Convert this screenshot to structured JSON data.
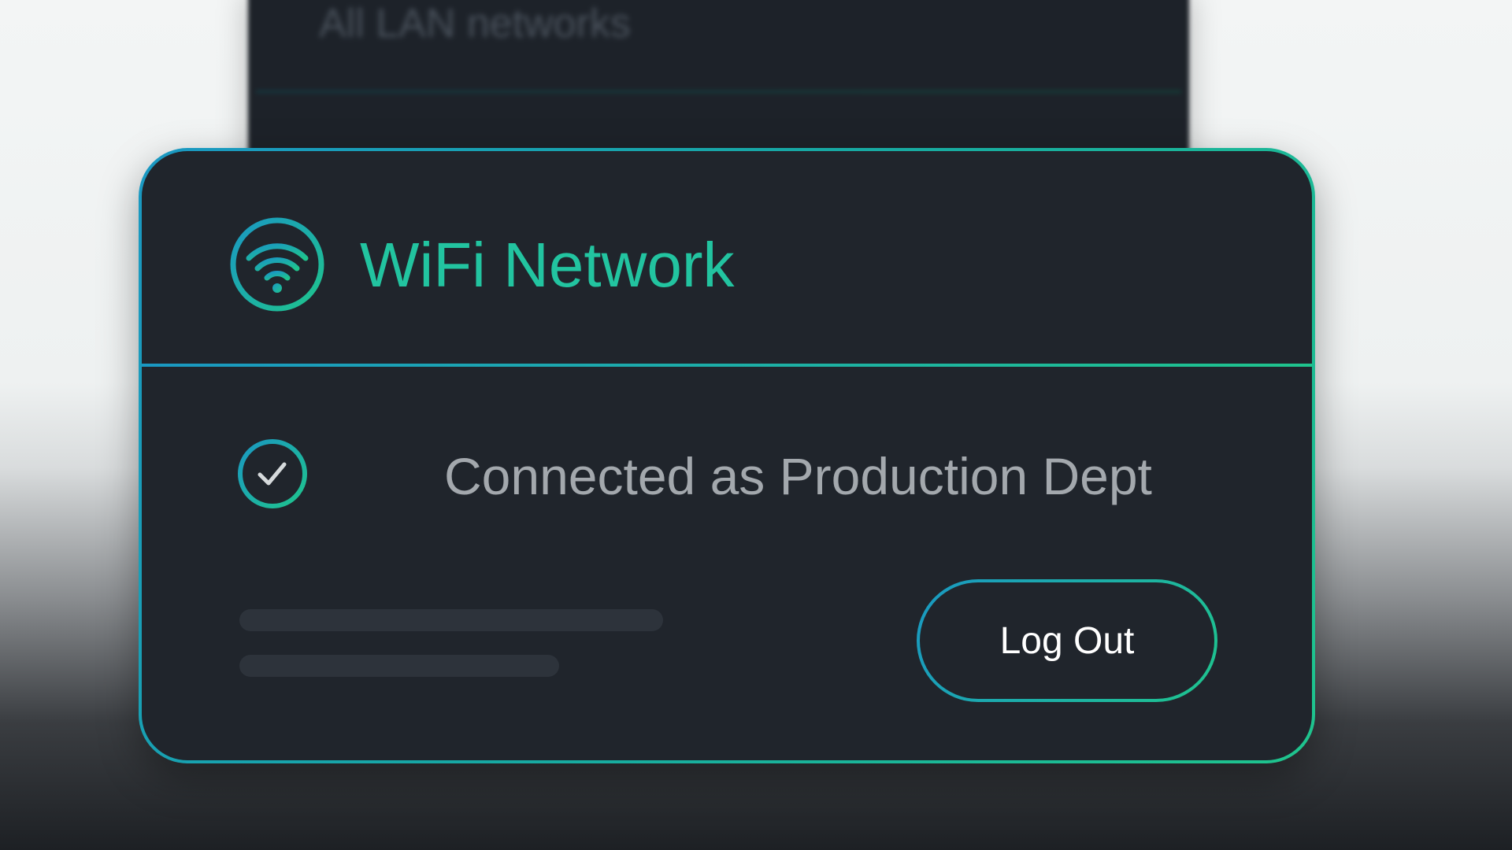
{
  "background": {
    "panel_text": "All LAN networks"
  },
  "card": {
    "title": "WiFi Network",
    "icon": "wifi-icon",
    "status_icon": "check-circle-icon",
    "status_text": "Connected as Production Dept",
    "logout_label": "Log Out",
    "colors": {
      "accent_blue": "#1a98c2",
      "accent_green": "#1fc48d",
      "title": "#22c4a0",
      "card_bg": "#20252c",
      "status_text": "#a3a8ad",
      "button_text": "#ffffff"
    }
  }
}
